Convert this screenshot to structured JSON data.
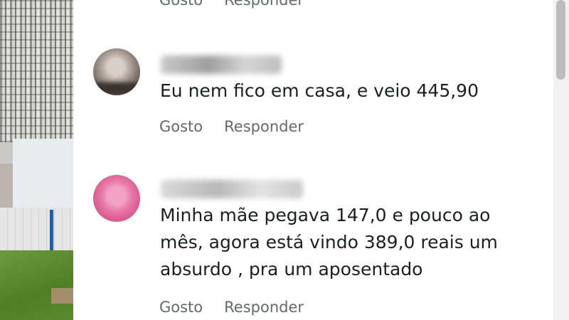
{
  "comments": [
    {
      "text": "Eu nem fico em casa, e veio 445,90",
      "like_label": "Gosto",
      "reply_label": "Responder"
    },
    {
      "text_lines": [
        "Minha mãe pegava 147,0 e pouco ao",
        "mês, agora está vindo 389,0 reais um",
        "absurdo , pra um aposentado"
      ],
      "like_label": "Gosto",
      "reply_label": "Responder"
    }
  ],
  "previous_comment_actions": {
    "like_label": "Gosto",
    "reply_label": "Responder"
  },
  "colors": {
    "action_text": "#65676b",
    "comment_text": "#1c1e21",
    "scrollbar_thumb": "#bcbcbc"
  }
}
